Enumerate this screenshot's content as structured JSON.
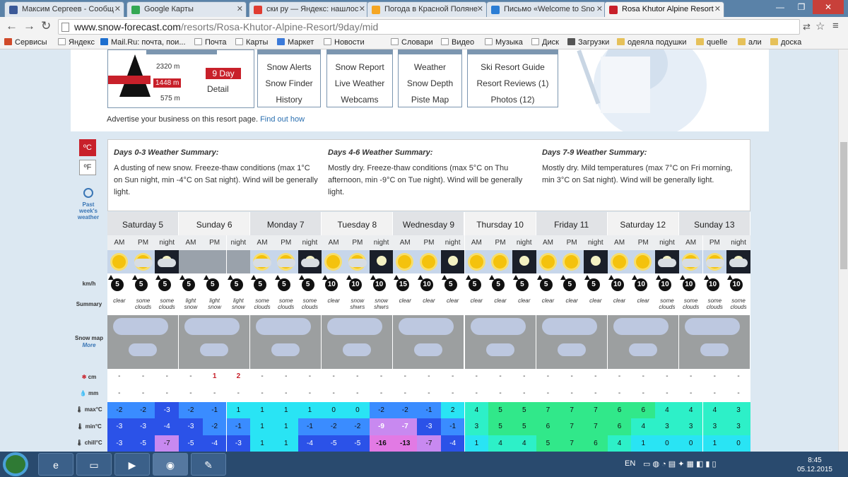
{
  "browser": {
    "tabs": [
      {
        "title": "Максим Сергеев - Сообщ",
        "color": "#3b5998"
      },
      {
        "title": "Google Карты",
        "color": "#34a853"
      },
      {
        "title": "ски ру — Яндекс: нашлос",
        "color": "#e03c31"
      },
      {
        "title": "Погода в Красной Поляне",
        "color": "#f5a623"
      },
      {
        "title": "Письмо «Welcome to Sno",
        "color": "#2b7dd4"
      },
      {
        "title": "Rosa Khutor Alpine Resort",
        "color": "#c8202a"
      }
    ],
    "url_host": "www.snow-forecast.com",
    "url_path": "/resorts/Rosa-Khutor-Alpine-Resort/9day/mid",
    "bookmarks": [
      "Сервисы",
      "Яндекс",
      "Mail.Ru: почта, пои...",
      "Почта",
      "Карты",
      "Маркет",
      "Новости",
      "Словари",
      "Видео",
      "Музыка",
      "Диск",
      "Загрузки",
      "одеяла подушки",
      "quelle",
      "али",
      "доска"
    ]
  },
  "resort": {
    "elev_top": "2320 m",
    "elev_mid": "1448 m",
    "elev_bot": "575 m",
    "day_button": "9 Day",
    "detail": "Detail",
    "menus": [
      [
        "Snow Alerts",
        "Snow Finder",
        "History"
      ],
      [
        "Snow Report",
        "Live Weather",
        "Webcams"
      ],
      [
        "Weather",
        "Snow Depth",
        "Piste Map"
      ],
      [
        "Ski Resort Guide",
        "Resort Reviews (1)",
        "Photos (12)"
      ]
    ],
    "advertise_text": "Advertise your business on this resort page.",
    "advertise_link": "Find out how"
  },
  "units": {
    "c": "ºC",
    "f": "ºF"
  },
  "past_weather": "Past week's weather",
  "summaries": [
    {
      "title": "Days 0-3 Weather Summary:",
      "text": "A dusting of new snow. Freeze-thaw conditions (max 1°C on Sun night, min -4°C on Sat night). Wind will be generally light."
    },
    {
      "title": "Days 4-6 Weather Summary:",
      "text": "Mostly dry. Freeze-thaw conditions (max 5°C on Thu afternoon, min -9°C on Tue night). Wind will be generally light."
    },
    {
      "title": "Days 7-9 Weather Summary:",
      "text": "Mostly dry. Mild temperatures (max 7°C on Fri morning, min 3°C on Sat night). Wind will be generally light."
    }
  ],
  "row_labels": {
    "wind": "km/h",
    "summary": "Summary",
    "snow_map": "Snow map",
    "more": "More",
    "snow": "cm",
    "rain": "mm",
    "max": "max°C",
    "min": "min°C",
    "chill": "chill°C"
  },
  "days": [
    "Saturday 5",
    "Sunday 6",
    "Monday 7",
    "Tuesday 8",
    "Wednesday 9",
    "Thursday 10",
    "Friday 11",
    "Saturday 12",
    "Sunday 13"
  ],
  "periods": [
    "AM",
    "PM",
    "night"
  ],
  "weather_icons": [
    "sun",
    "sun-cloud",
    "moon-cloud",
    "snow",
    "snow",
    "snow",
    "sun-cloud",
    "sun-cloud",
    "moon-cloud",
    "sun",
    "sun-cloud",
    "moon",
    "sun",
    "sun",
    "moon",
    "sun",
    "sun",
    "moon",
    "sun",
    "sun",
    "moon",
    "sun",
    "sun",
    "moon-cloud",
    "sun-cloud",
    "sun-cloud",
    "moon-cloud"
  ],
  "wind": [
    5,
    5,
    5,
    5,
    5,
    5,
    5,
    5,
    5,
    10,
    10,
    10,
    15,
    10,
    5,
    5,
    5,
    5,
    5,
    5,
    5,
    10,
    10,
    10,
    10,
    10,
    10
  ],
  "summary": [
    "clear",
    "some clouds",
    "some clouds",
    "light snow",
    "light snow",
    "light snow",
    "some clouds",
    "some clouds",
    "some clouds",
    "clear",
    "snow shwrs",
    "snow shwrs",
    "clear",
    "clear",
    "clear",
    "clear",
    "clear",
    "clear",
    "clear",
    "clear",
    "clear",
    "clear",
    "clear",
    "some clouds",
    "some clouds",
    "some clouds",
    "some clouds"
  ],
  "snow_cm": [
    "-",
    "-",
    "-",
    "-",
    "1",
    "2",
    "-",
    "-",
    "-",
    "-",
    "-",
    "-",
    "-",
    "-",
    "-",
    "-",
    "-",
    "-",
    "-",
    "-",
    "-",
    "-",
    "-",
    "-",
    "-",
    "-",
    "-"
  ],
  "rain_mm": [
    "-",
    "-",
    "-",
    "-",
    "-",
    "-",
    "-",
    "-",
    "-",
    "-",
    "-",
    "-",
    "-",
    "-",
    "-",
    "-",
    "-",
    "-",
    "-",
    "-",
    "-",
    "-",
    "-",
    "-",
    "-",
    "-",
    "-"
  ],
  "max_c": [
    -2,
    -2,
    -3,
    -2,
    -1,
    1,
    1,
    1,
    1,
    0,
    0,
    -2,
    -2,
    -1,
    2,
    4,
    5,
    5,
    7,
    7,
    7,
    6,
    6,
    4,
    4,
    4,
    3
  ],
  "min_c": [
    -3,
    -3,
    -4,
    -3,
    -2,
    -1,
    1,
    1,
    -1,
    -2,
    -2,
    -9,
    -7,
    -3,
    -1,
    3,
    5,
    5,
    6,
    7,
    7,
    6,
    4,
    3,
    3,
    3,
    3
  ],
  "chill_c": [
    -3,
    -5,
    -7,
    -5,
    -4,
    -3,
    1,
    1,
    -4,
    -5,
    -5,
    -16,
    -13,
    -7,
    -4,
    1,
    4,
    4,
    5,
    7,
    6,
    4,
    1,
    0,
    0,
    1,
    0
  ],
  "taskbar": {
    "lang": "EN",
    "time": "8:45",
    "date": "05.12.2015"
  }
}
